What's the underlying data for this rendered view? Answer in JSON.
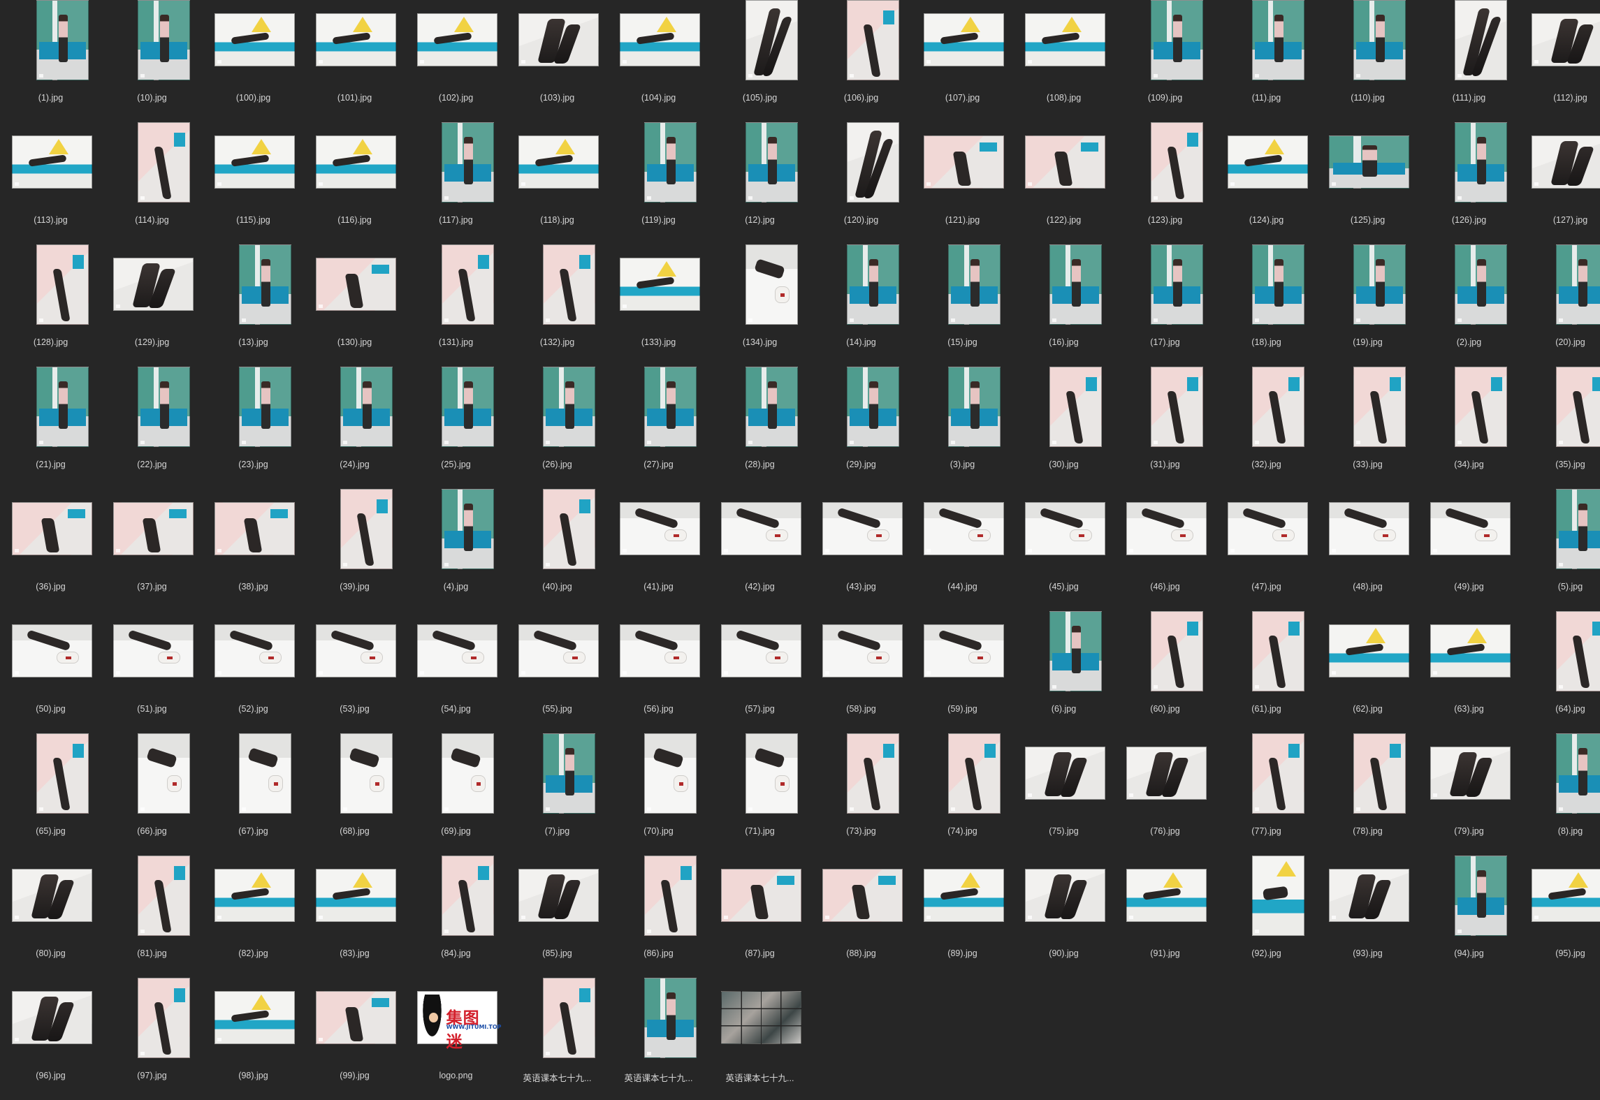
{
  "window": {
    "view": "icon-grid"
  },
  "colors": {
    "background": "#262626",
    "label_text": "#d6d6d6",
    "sofa_teal": "#1a8fb6",
    "wall_green": "#5ba295"
  },
  "files": [
    {
      "name": "(1).jpg",
      "orientation": "portrait",
      "scene": "room"
    },
    {
      "name": "(10).jpg",
      "orientation": "portrait",
      "scene": "room"
    },
    {
      "name": "(100).jpg",
      "orientation": "landscape",
      "scene": "teal"
    },
    {
      "name": "(101).jpg",
      "orientation": "landscape",
      "scene": "teal"
    },
    {
      "name": "(102).jpg",
      "orientation": "landscape",
      "scene": "teal"
    },
    {
      "name": "(103).jpg",
      "orientation": "landscape",
      "scene": "legs"
    },
    {
      "name": "(104).jpg",
      "orientation": "landscape",
      "scene": "teal"
    },
    {
      "name": "(105).jpg",
      "orientation": "portrait",
      "scene": "legs"
    },
    {
      "name": "(106).jpg",
      "orientation": "portrait",
      "scene": "pink"
    },
    {
      "name": "(107).jpg",
      "orientation": "landscape",
      "scene": "teal"
    },
    {
      "name": "(108).jpg",
      "orientation": "landscape",
      "scene": "teal"
    },
    {
      "name": "(109).jpg",
      "orientation": "portrait",
      "scene": "room"
    },
    {
      "name": "(11).jpg",
      "orientation": "portrait",
      "scene": "room"
    },
    {
      "name": "(110).jpg",
      "orientation": "portrait",
      "scene": "room"
    },
    {
      "name": "(111).jpg",
      "orientation": "portrait",
      "scene": "legs"
    },
    {
      "name": "(112).jpg",
      "orientation": "landscape",
      "scene": "legs"
    },
    {
      "name": "(113).jpg",
      "orientation": "landscape",
      "scene": "teal"
    },
    {
      "name": "(114).jpg",
      "orientation": "portrait",
      "scene": "pink"
    },
    {
      "name": "(115).jpg",
      "orientation": "landscape",
      "scene": "teal"
    },
    {
      "name": "(116).jpg",
      "orientation": "landscape",
      "scene": "teal"
    },
    {
      "name": "(117).jpg",
      "orientation": "portrait",
      "scene": "room"
    },
    {
      "name": "(118).jpg",
      "orientation": "landscape",
      "scene": "teal"
    },
    {
      "name": "(119).jpg",
      "orientation": "portrait",
      "scene": "room"
    },
    {
      "name": "(12).jpg",
      "orientation": "portrait",
      "scene": "room"
    },
    {
      "name": "(120).jpg",
      "orientation": "portrait",
      "scene": "legs"
    },
    {
      "name": "(121).jpg",
      "orientation": "landscape",
      "scene": "pink"
    },
    {
      "name": "(122).jpg",
      "orientation": "landscape",
      "scene": "pink"
    },
    {
      "name": "(123).jpg",
      "orientation": "portrait",
      "scene": "pink"
    },
    {
      "name": "(124).jpg",
      "orientation": "landscape",
      "scene": "teal"
    },
    {
      "name": "(125).jpg",
      "orientation": "landscape",
      "scene": "room"
    },
    {
      "name": "(126).jpg",
      "orientation": "portrait",
      "scene": "room"
    },
    {
      "name": "(127).jpg",
      "orientation": "landscape",
      "scene": "legs"
    },
    {
      "name": "(128).jpg",
      "orientation": "portrait",
      "scene": "pink"
    },
    {
      "name": "(129).jpg",
      "orientation": "landscape",
      "scene": "legs"
    },
    {
      "name": "(13).jpg",
      "orientation": "portrait",
      "scene": "room"
    },
    {
      "name": "(130).jpg",
      "orientation": "landscape",
      "scene": "pink"
    },
    {
      "name": "(131).jpg",
      "orientation": "portrait",
      "scene": "pink"
    },
    {
      "name": "(132).jpg",
      "orientation": "portrait",
      "scene": "pink"
    },
    {
      "name": "(133).jpg",
      "orientation": "landscape",
      "scene": "teal"
    },
    {
      "name": "(134).jpg",
      "orientation": "portrait",
      "scene": "floor"
    },
    {
      "name": "(14).jpg",
      "orientation": "portrait",
      "scene": "room"
    },
    {
      "name": "(15).jpg",
      "orientation": "portrait",
      "scene": "room"
    },
    {
      "name": "(16).jpg",
      "orientation": "portrait",
      "scene": "room"
    },
    {
      "name": "(17).jpg",
      "orientation": "portrait",
      "scene": "room"
    },
    {
      "name": "(18).jpg",
      "orientation": "portrait",
      "scene": "room"
    },
    {
      "name": "(19).jpg",
      "orientation": "portrait",
      "scene": "room"
    },
    {
      "name": "(2).jpg",
      "orientation": "portrait",
      "scene": "room"
    },
    {
      "name": "(20).jpg",
      "orientation": "portrait",
      "scene": "room"
    },
    {
      "name": "(21).jpg",
      "orientation": "portrait",
      "scene": "room"
    },
    {
      "name": "(22).jpg",
      "orientation": "portrait",
      "scene": "room"
    },
    {
      "name": "(23).jpg",
      "orientation": "portrait",
      "scene": "room"
    },
    {
      "name": "(24).jpg",
      "orientation": "portrait",
      "scene": "room"
    },
    {
      "name": "(25).jpg",
      "orientation": "portrait",
      "scene": "room"
    },
    {
      "name": "(26).jpg",
      "orientation": "portrait",
      "scene": "room"
    },
    {
      "name": "(27).jpg",
      "orientation": "portrait",
      "scene": "room"
    },
    {
      "name": "(28).jpg",
      "orientation": "portrait",
      "scene": "room"
    },
    {
      "name": "(29).jpg",
      "orientation": "portrait",
      "scene": "room"
    },
    {
      "name": "(3).jpg",
      "orientation": "portrait",
      "scene": "room"
    },
    {
      "name": "(30).jpg",
      "orientation": "portrait",
      "scene": "pink"
    },
    {
      "name": "(31).jpg",
      "orientation": "portrait",
      "scene": "pink"
    },
    {
      "name": "(32).jpg",
      "orientation": "portrait",
      "scene": "pink"
    },
    {
      "name": "(33).jpg",
      "orientation": "portrait",
      "scene": "pink"
    },
    {
      "name": "(34).jpg",
      "orientation": "portrait",
      "scene": "pink"
    },
    {
      "name": "(35).jpg",
      "orientation": "portrait",
      "scene": "pink"
    },
    {
      "name": "(36).jpg",
      "orientation": "landscape",
      "scene": "pink"
    },
    {
      "name": "(37).jpg",
      "orientation": "landscape",
      "scene": "pink"
    },
    {
      "name": "(38).jpg",
      "orientation": "landscape",
      "scene": "pink"
    },
    {
      "name": "(39).jpg",
      "orientation": "portrait",
      "scene": "pink"
    },
    {
      "name": "(4).jpg",
      "orientation": "portrait",
      "scene": "room"
    },
    {
      "name": "(40).jpg",
      "orientation": "portrait",
      "scene": "pink"
    },
    {
      "name": "(41).jpg",
      "orientation": "landscape",
      "scene": "floor"
    },
    {
      "name": "(42).jpg",
      "orientation": "landscape",
      "scene": "floor"
    },
    {
      "name": "(43).jpg",
      "orientation": "landscape",
      "scene": "floor"
    },
    {
      "name": "(44).jpg",
      "orientation": "landscape",
      "scene": "floor"
    },
    {
      "name": "(45).jpg",
      "orientation": "landscape",
      "scene": "floor"
    },
    {
      "name": "(46).jpg",
      "orientation": "landscape",
      "scene": "floor"
    },
    {
      "name": "(47).jpg",
      "orientation": "landscape",
      "scene": "floor"
    },
    {
      "name": "(48).jpg",
      "orientation": "landscape",
      "scene": "floor"
    },
    {
      "name": "(49).jpg",
      "orientation": "landscape",
      "scene": "floor"
    },
    {
      "name": "(5).jpg",
      "orientation": "portrait",
      "scene": "room"
    },
    {
      "name": "(50).jpg",
      "orientation": "landscape",
      "scene": "floor"
    },
    {
      "name": "(51).jpg",
      "orientation": "landscape",
      "scene": "floor"
    },
    {
      "name": "(52).jpg",
      "orientation": "landscape",
      "scene": "floor"
    },
    {
      "name": "(53).jpg",
      "orientation": "landscape",
      "scene": "floor"
    },
    {
      "name": "(54).jpg",
      "orientation": "landscape",
      "scene": "floor"
    },
    {
      "name": "(55).jpg",
      "orientation": "landscape",
      "scene": "floor"
    },
    {
      "name": "(56).jpg",
      "orientation": "landscape",
      "scene": "floor"
    },
    {
      "name": "(57).jpg",
      "orientation": "landscape",
      "scene": "floor"
    },
    {
      "name": "(58).jpg",
      "orientation": "landscape",
      "scene": "floor"
    },
    {
      "name": "(59).jpg",
      "orientation": "landscape",
      "scene": "floor"
    },
    {
      "name": "(6).jpg",
      "orientation": "portrait",
      "scene": "room"
    },
    {
      "name": "(60).jpg",
      "orientation": "portrait",
      "scene": "pink"
    },
    {
      "name": "(61).jpg",
      "orientation": "portrait",
      "scene": "pink"
    },
    {
      "name": "(62).jpg",
      "orientation": "landscape",
      "scene": "teal"
    },
    {
      "name": "(63).jpg",
      "orientation": "landscape",
      "scene": "teal"
    },
    {
      "name": "(64).jpg",
      "orientation": "portrait",
      "scene": "pink"
    },
    {
      "name": "(65).jpg",
      "orientation": "portrait",
      "scene": "pink"
    },
    {
      "name": "(66).jpg",
      "orientation": "portrait",
      "scene": "floor"
    },
    {
      "name": "(67).jpg",
      "orientation": "portrait",
      "scene": "floor"
    },
    {
      "name": "(68).jpg",
      "orientation": "portrait",
      "scene": "floor"
    },
    {
      "name": "(69).jpg",
      "orientation": "portrait",
      "scene": "floor"
    },
    {
      "name": "(7).jpg",
      "orientation": "portrait",
      "scene": "room"
    },
    {
      "name": "(70).jpg",
      "orientation": "portrait",
      "scene": "floor"
    },
    {
      "name": "(71).jpg",
      "orientation": "portrait",
      "scene": "floor"
    },
    {
      "name": "(73).jpg",
      "orientation": "portrait",
      "scene": "pink"
    },
    {
      "name": "(74).jpg",
      "orientation": "portrait",
      "scene": "pink"
    },
    {
      "name": "(75).jpg",
      "orientation": "landscape",
      "scene": "legs"
    },
    {
      "name": "(76).jpg",
      "orientation": "landscape",
      "scene": "legs"
    },
    {
      "name": "(77).jpg",
      "orientation": "portrait",
      "scene": "pink"
    },
    {
      "name": "(78).jpg",
      "orientation": "portrait",
      "scene": "pink"
    },
    {
      "name": "(79).jpg",
      "orientation": "landscape",
      "scene": "legs"
    },
    {
      "name": "(8).jpg",
      "orientation": "portrait",
      "scene": "room"
    },
    {
      "name": "(80).jpg",
      "orientation": "landscape",
      "scene": "legs"
    },
    {
      "name": "(81).jpg",
      "orientation": "portrait",
      "scene": "pink"
    },
    {
      "name": "(82).jpg",
      "orientation": "landscape",
      "scene": "teal"
    },
    {
      "name": "(83).jpg",
      "orientation": "landscape",
      "scene": "teal"
    },
    {
      "name": "(84).jpg",
      "orientation": "portrait",
      "scene": "pink"
    },
    {
      "name": "(85).jpg",
      "orientation": "landscape",
      "scene": "legs"
    },
    {
      "name": "(86).jpg",
      "orientation": "portrait",
      "scene": "pink"
    },
    {
      "name": "(87).jpg",
      "orientation": "landscape",
      "scene": "pink"
    },
    {
      "name": "(88).jpg",
      "orientation": "landscape",
      "scene": "pink"
    },
    {
      "name": "(89).jpg",
      "orientation": "landscape",
      "scene": "teal"
    },
    {
      "name": "(90).jpg",
      "orientation": "landscape",
      "scene": "legs"
    },
    {
      "name": "(91).jpg",
      "orientation": "landscape",
      "scene": "teal"
    },
    {
      "name": "(92).jpg",
      "orientation": "portrait",
      "scene": "teal"
    },
    {
      "name": "(93).jpg",
      "orientation": "landscape",
      "scene": "legs"
    },
    {
      "name": "(94).jpg",
      "orientation": "portrait",
      "scene": "room"
    },
    {
      "name": "(95).jpg",
      "orientation": "landscape",
      "scene": "teal"
    },
    {
      "name": "(96).jpg",
      "orientation": "landscape",
      "scene": "legs"
    },
    {
      "name": "(97).jpg",
      "orientation": "portrait",
      "scene": "pink"
    },
    {
      "name": "(98).jpg",
      "orientation": "landscape",
      "scene": "teal"
    },
    {
      "name": "(99).jpg",
      "orientation": "landscape",
      "scene": "pink"
    },
    {
      "name": "logo.png",
      "orientation": "landscape",
      "scene": "logo",
      "logo_text": "集图迷",
      "logo_url": "WWW.JITUMI.TOP"
    },
    {
      "name": "英语课本七十九...",
      "orientation": "portrait",
      "scene": "pink"
    },
    {
      "name": "英语课本七十九...",
      "orientation": "portrait",
      "scene": "room"
    },
    {
      "name": "英语课本七十九...",
      "orientation": "landscape",
      "scene": "contact"
    }
  ]
}
